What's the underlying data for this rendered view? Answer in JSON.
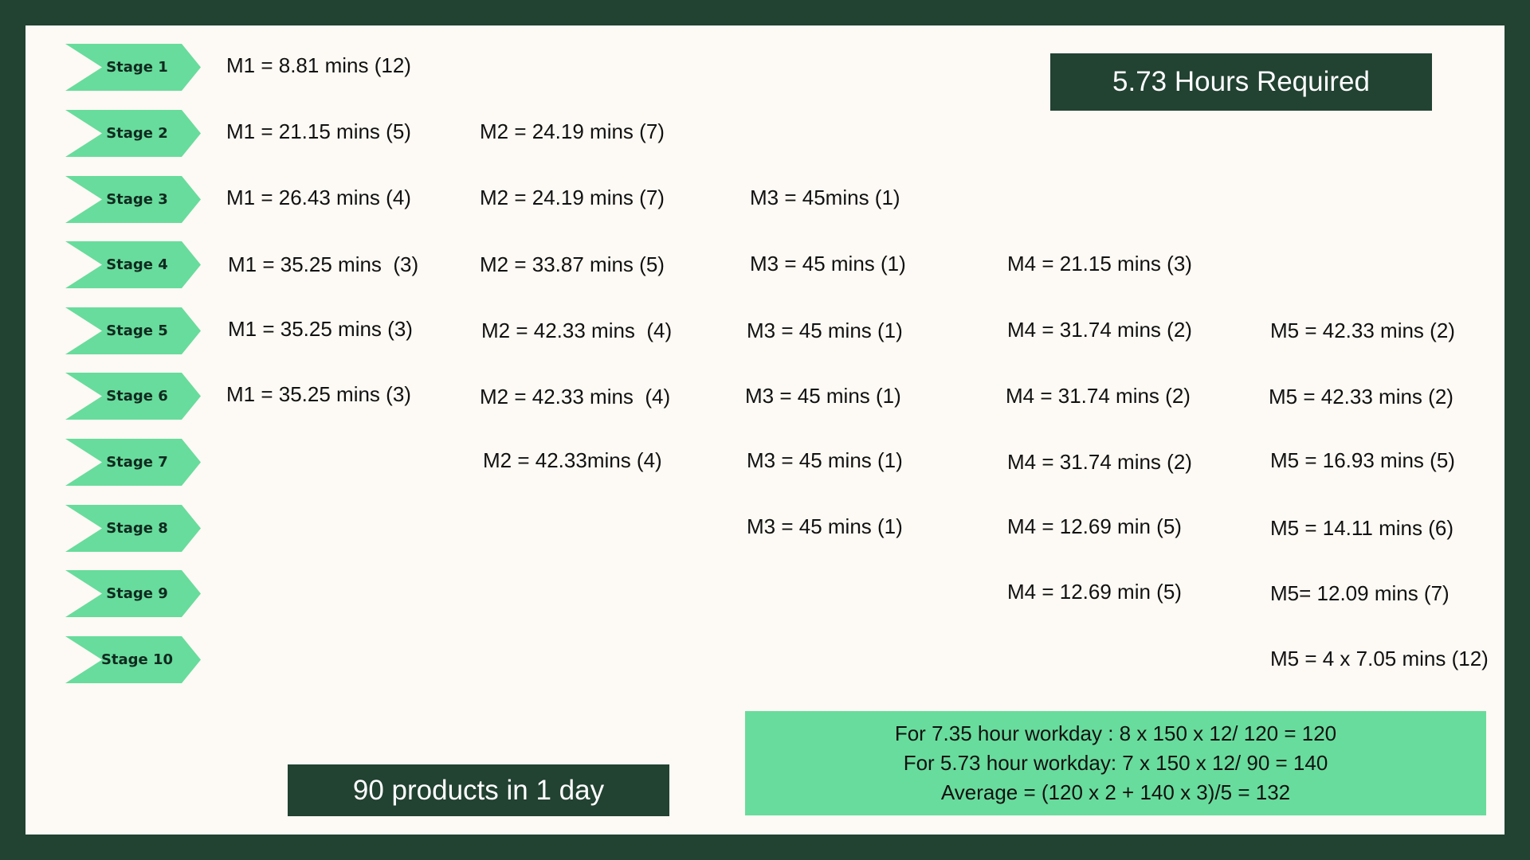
{
  "header": {
    "hours_required": "5.73 Hours Required"
  },
  "stages": [
    {
      "label": "Stage 1",
      "m1": "M1 = 8.81 mins (12)",
      "m2": "",
      "m3": "",
      "m4": "",
      "m5": ""
    },
    {
      "label": "Stage 2",
      "m1": "M1 = 21.15 mins (5)",
      "m2": "M2 = 24.19 mins (7)",
      "m3": "",
      "m4": "",
      "m5": ""
    },
    {
      "label": "Stage 3",
      "m1": "M1 = 26.43 mins (4)",
      "m2": "M2 = 24.19 mins (7)",
      "m3": "M3 = 45mins (1)",
      "m4": "",
      "m5": ""
    },
    {
      "label": "Stage 4",
      "m1": "M1 = 35.25 mins  (3)",
      "m2": "M2 = 33.87 mins (5)",
      "m3": "M3 = 45 mins (1)",
      "m4": "M4 = 21.15 mins (3)",
      "m5": ""
    },
    {
      "label": "Stage 5",
      "m1": "M1 = 35.25 mins (3)",
      "m2": "M2 = 42.33 mins  (4)",
      "m3": "M3 = 45 mins (1)",
      "m4": "M4 = 31.74 mins (2)",
      "m5": "M5 = 42.33 mins (2)"
    },
    {
      "label": "Stage 6",
      "m1": "M1 = 35.25 mins (3)",
      "m2": "M2 = 42.33 mins  (4)",
      "m3": "M3 = 45 mins (1)",
      "m4": "M4 = 31.74 mins (2)",
      "m5": "M5 = 42.33 mins (2)"
    },
    {
      "label": "Stage 7",
      "m1": "",
      "m2": "M2 = 42.33mins (4)",
      "m3": "M3 = 45 mins (1)",
      "m4": "M4 = 31.74 mins (2)",
      "m5": "M5 = 16.93 mins (5)"
    },
    {
      "label": "Stage 8",
      "m1": "",
      "m2": "",
      "m3": "M3 = 45 mins (1)",
      "m4": "M4 = 12.69 min (5)",
      "m5": "M5 = 14.11 mins (6)"
    },
    {
      "label": "Stage 9",
      "m1": "",
      "m2": "",
      "m3": "",
      "m4": "M4 = 12.69 min (5)",
      "m5": "M5= 12.09 mins (7)"
    },
    {
      "label": "Stage 10",
      "m1": "",
      "m2": "",
      "m3": "",
      "m4": "",
      "m5": "M5 = 4 x 7.05 mins (12)"
    }
  ],
  "footer": {
    "products_per_day": "90 products in 1 day",
    "calc_lines": [
      "For 7.35 hour workday : 8 x 150 x 12/ 120 = 120",
      "For 5.73 hour workday: 7 x 150 x 12/ 90 = 140",
      "Average = (120 x 2 + 140 x 3)/5 = 132"
    ]
  },
  "colors": {
    "frame": "#224232",
    "accent": "#68dc9c",
    "background": "#fdf9f4"
  }
}
